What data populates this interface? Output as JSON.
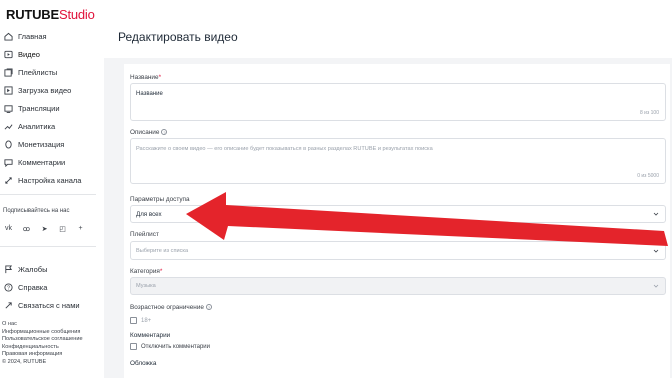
{
  "app": {
    "logo_main": "RUTUBE",
    "logo_suffix": "Studio"
  },
  "sidebar": {
    "items": [
      {
        "label": "Главная",
        "icon": "home-icon"
      },
      {
        "label": "Видео",
        "icon": "video-icon"
      },
      {
        "label": "Плейлисты",
        "icon": "playlist-icon"
      },
      {
        "label": "Загрузка видео",
        "icon": "upload-icon"
      },
      {
        "label": "Трансляции",
        "icon": "broadcast-icon"
      },
      {
        "label": "Аналитика",
        "icon": "analytics-icon"
      },
      {
        "label": "Монетизация",
        "icon": "monetization-icon"
      },
      {
        "label": "Комментарии",
        "icon": "comments-icon"
      },
      {
        "label": "Настройка канала",
        "icon": "settings-icon"
      }
    ],
    "subscribe_label": "Подписывайтесь на нас",
    "socials": [
      "vk-icon",
      "ok-icon",
      "telegram-icon",
      "viber-icon",
      "plus-icon"
    ],
    "bottom_items": [
      {
        "label": "Жалобы",
        "icon": "flag-icon"
      },
      {
        "label": "Справка",
        "icon": "help-icon"
      },
      {
        "label": "Связаться с нами",
        "icon": "contact-icon"
      }
    ],
    "links": [
      "О нас",
      "Информационные сообщения",
      "Пользовательское соглашение",
      "Конфиденциальность",
      "Правовая информация",
      "© 2024, RUTUBE"
    ]
  },
  "main": {
    "page_title": "Редактировать видео",
    "title_field": {
      "label": "Название",
      "required_mark": "*",
      "value": "Название",
      "counter": "8 из 100"
    },
    "description_field": {
      "label": "Описание",
      "placeholder": "Расскажите о своем видео — его описание будет показываться в разных разделах RUTUBE и результатах поиска",
      "counter": "0 из 5000"
    },
    "access_field": {
      "label": "Параметры доступа",
      "value": "Для всех"
    },
    "playlist_field": {
      "label": "Плейлист",
      "placeholder": "Выберите из списка"
    },
    "category_field": {
      "label": "Категория",
      "required_mark": "*",
      "value": "Музыка"
    },
    "age_field": {
      "label": "Возрастное ограничение",
      "checkbox_label": "18+"
    },
    "comments_field": {
      "label": "Комментарии",
      "checkbox_label": "Отключить комментарии"
    },
    "cover_field": {
      "label": "Обложка"
    }
  },
  "colors": {
    "accent": "#e0123a",
    "arrow": "#e4242b",
    "content_bg": "#f3f4f6"
  }
}
